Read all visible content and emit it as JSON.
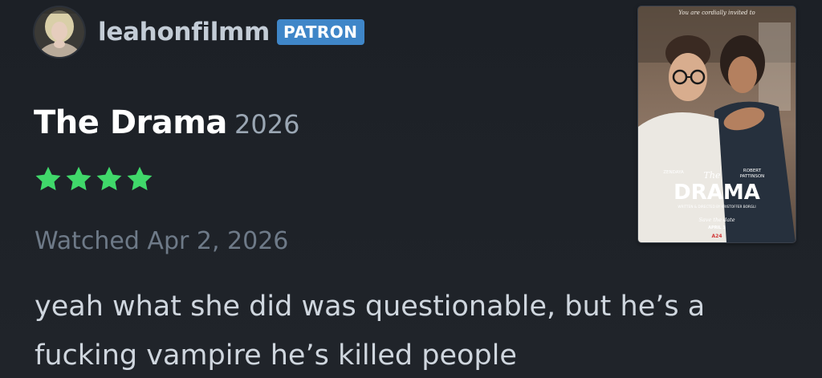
{
  "user": {
    "username": "leahonfilmm",
    "badge": "PATRON"
  },
  "film": {
    "title": "The Drama",
    "year": "2026",
    "rating_stars": 4,
    "rating_max": 5,
    "rating_color": "#40bcf4"
  },
  "entry": {
    "watched": "Watched Apr 2, 2026",
    "review": "yeah what she did was questionable, but he’s a fucking vampire he’s killed people"
  },
  "poster": {
    "tagline": "You are cordially invited to",
    "cast_left": "ZENDAYA",
    "cast_right_1": "ROBERT",
    "cast_right_2": "PATTINSON",
    "title_small": "The",
    "title_large": "DRAMA",
    "credit": "WRITTEN & DIRECTED BY KRISTOFFER BORGLI",
    "save_the_date": "Save the date",
    "release": "APRIL 3",
    "studio": "A24"
  },
  "colors": {
    "background": "#1e2227",
    "star": "#40d86a",
    "badge": "#3f86c8"
  }
}
